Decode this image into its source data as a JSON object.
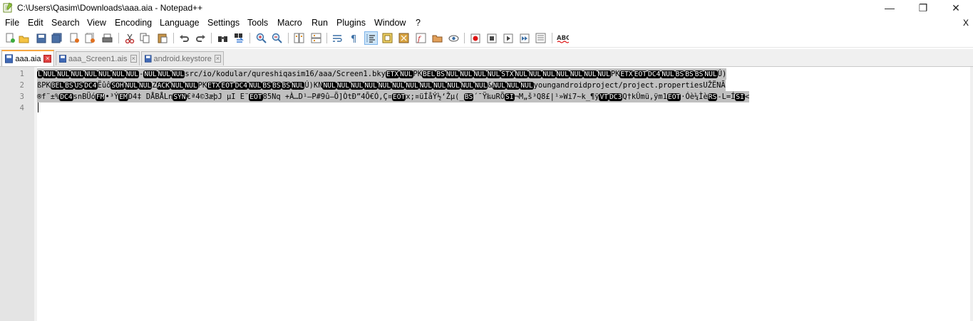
{
  "window": {
    "title": "C:\\Users\\Qasim\\Downloads\\aaa.aia - Notepad++",
    "minimize": "—",
    "maximize": "❐",
    "close": "✕"
  },
  "menu": {
    "items": [
      "File",
      "Edit",
      "Search",
      "View",
      "Encoding",
      "Language",
      "Settings",
      "Tools",
      "Macro",
      "Run",
      "Plugins",
      "Window",
      "?"
    ],
    "close": "X"
  },
  "tabs": [
    {
      "label": "aaa.aia",
      "active": true
    },
    {
      "label": "aaa_Screen1.ais",
      "active": false
    },
    {
      "label": "android.keystore",
      "active": false
    }
  ],
  "tab_close": "×",
  "editor": {
    "line_numbers": [
      "1",
      "2",
      "3",
      "4"
    ],
    "lines": [
      [
        [
          "c",
          "L"
        ],
        [
          "c",
          "NUL"
        ],
        [
          "c",
          "NUL"
        ],
        [
          "c",
          "NUL"
        ],
        [
          "c",
          "NUL"
        ],
        [
          "c",
          "NUL"
        ],
        [
          "c",
          "NUL"
        ],
        [
          "c",
          "NUL"
        ],
        [
          "t",
          "-"
        ],
        [
          "c",
          "NUL"
        ],
        [
          "c",
          "NUL"
        ],
        [
          "c",
          "NUL"
        ],
        [
          "t",
          "src/io/kodular/qureshiqasim16/aaa/Screen1.bky"
        ],
        [
          "c",
          "ETX"
        ],
        [
          "c",
          "NUL"
        ],
        [
          "t",
          "PK"
        ],
        [
          "c",
          "BEL"
        ],
        [
          "c",
          "BS"
        ],
        [
          "c",
          "NUL"
        ],
        [
          "c",
          "NUL"
        ],
        [
          "c",
          "NUL"
        ],
        [
          "c",
          "NUL"
        ],
        [
          "c",
          "STX"
        ],
        [
          "c",
          "NUL"
        ],
        [
          "c",
          "NUL"
        ],
        [
          "c",
          "NUL"
        ],
        [
          "c",
          "NUL"
        ],
        [
          "c",
          "NUL"
        ],
        [
          "c",
          "NUL"
        ],
        [
          "c",
          "NUL"
        ],
        [
          "t",
          "PK"
        ],
        [
          "c",
          "ETX"
        ],
        [
          "c",
          "EOT"
        ],
        [
          "c",
          "DC4"
        ],
        [
          "c",
          "NUL"
        ],
        [
          "c",
          "BS"
        ],
        [
          "c",
          "BS"
        ],
        [
          "c",
          "BS"
        ],
        [
          "c",
          "NUL"
        ],
        [
          "t",
          "Ú)"
        ]
      ],
      [
        [
          "t",
          "ß"
        ],
        [
          "t",
          "PK"
        ],
        [
          "c",
          "BEL"
        ],
        [
          "c",
          "BS"
        ],
        [
          "c",
          "US"
        ],
        [
          "c",
          "DC4"
        ],
        [
          "t",
          "Ëûô"
        ],
        [
          "c",
          "SOH"
        ],
        [
          "c",
          "NUL"
        ],
        [
          "c",
          "NUL"
        ],
        [
          "t",
          "Z"
        ],
        [
          "c",
          "ACK"
        ],
        [
          "c",
          "NUL"
        ],
        [
          "c",
          "NUL"
        ],
        [
          "t",
          "PK"
        ],
        [
          "c",
          "ETX"
        ],
        [
          "c",
          "EOT"
        ],
        [
          "c",
          "DC4"
        ],
        [
          "c",
          "NUL"
        ],
        [
          "c",
          "BS"
        ],
        [
          "c",
          "BS"
        ],
        [
          "c",
          "BS"
        ],
        [
          "c",
          "NUL"
        ],
        [
          "t",
          "Ú)KN"
        ],
        [
          "c",
          "NUL"
        ],
        [
          "c",
          "NUL"
        ],
        [
          "c",
          "NUL"
        ],
        [
          "c",
          "NUL"
        ],
        [
          "c",
          "NUL"
        ],
        [
          "c",
          "NUL"
        ],
        [
          "c",
          "NUL"
        ],
        [
          "c",
          "NUL"
        ],
        [
          "c",
          "NUL"
        ],
        [
          "c",
          "NUL"
        ],
        [
          "c",
          "NUL"
        ],
        [
          "c",
          "NUL"
        ],
        [
          "t",
          "&"
        ],
        [
          "c",
          "NUL"
        ],
        [
          "c",
          "NUL"
        ],
        [
          "c",
          "NUL"
        ],
        [
          "t",
          "youngandroidproject/project.propertiesUŽËNÃ"
        ]
      ],
      [
        [
          "t",
          "®f¨±%"
        ],
        [
          "c",
          "DC4"
        ],
        [
          "t",
          "snBÜó"
        ],
        [
          "c",
          "FM"
        ],
        [
          "t",
          "•³Ý"
        ],
        [
          "c",
          "EM"
        ],
        [
          "t",
          "D4‡ DÅBÅLn"
        ],
        [
          "c",
          "SYN"
        ],
        [
          "t",
          "€ª4©3æþJ µI E¨"
        ],
        [
          "c",
          "EOT"
        ],
        [
          "t",
          "85Nq   +À…D¹–P#9û—Õ]ÒtÐ”4Õ€Ó,Ç¤"
        ],
        [
          "c",
          "EOT"
        ],
        [
          "t",
          "x;¤üÍåÝ½‘Žµ(_"
        ],
        [
          "c",
          "BS"
        ],
        [
          "t",
          "´¯Ÿ‰uRÕ"
        ],
        [
          "c",
          "SI"
        ],
        [
          "t",
          "¬M„š³Q8£|¹»Wi7~k_¶ÿ"
        ],
        [
          "c",
          "VT"
        ],
        [
          "c",
          "DC3"
        ],
        [
          "t",
          "Q†kÛmü‚ÿm1"
        ],
        [
          "c",
          "EOT"
        ],
        [
          "t",
          "·Óè¼Ìè"
        ],
        [
          "c",
          "RS"
        ],
        [
          "t",
          "-L=Í"
        ],
        [
          "c",
          "SI"
        ],
        [
          "t",
          "<"
        ]
      ],
      []
    ]
  }
}
